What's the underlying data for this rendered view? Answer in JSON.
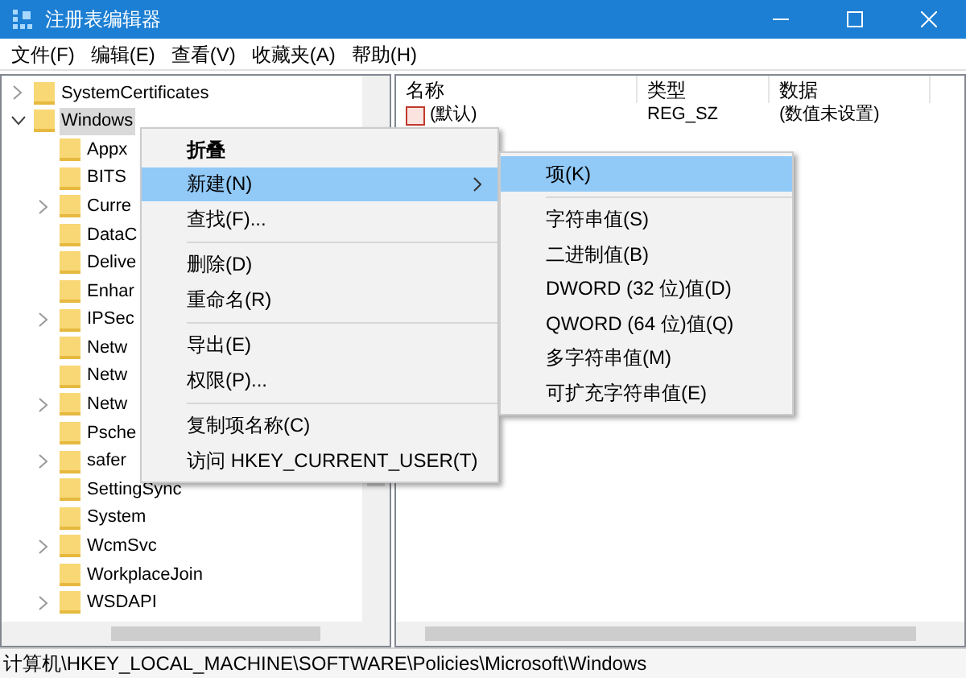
{
  "window": {
    "title": "注册表编辑器"
  },
  "menu_bar": [
    "文件(F)",
    "编辑(E)",
    "查看(V)",
    "收藏夹(A)",
    "帮助(H)"
  ],
  "tree": [
    {
      "label": "SystemCertificates",
      "expanded": false,
      "selected": false
    },
    {
      "label": "Windows",
      "expanded": true,
      "selected": true,
      "children": [
        {
          "label": "Appx",
          "selected": false
        },
        {
          "label": "BITS",
          "selected": false
        },
        {
          "label": "Curre",
          "expanded": false,
          "selected": false
        },
        {
          "label": "DataC",
          "selected": false
        },
        {
          "label": "Delive",
          "selected": false
        },
        {
          "label": "Enhar",
          "selected": false
        },
        {
          "label": "IPSec",
          "expanded": false,
          "selected": false
        },
        {
          "label": "Netw",
          "selected": false
        },
        {
          "label": "Netw",
          "selected": false
        },
        {
          "label": "Netw",
          "expanded": false,
          "selected": false
        },
        {
          "label": "Psche",
          "selected": false
        },
        {
          "label": "safer",
          "expanded": false,
          "selected": false
        },
        {
          "label": "SettingSync",
          "selected": false
        },
        {
          "label": "System",
          "selected": false
        },
        {
          "label": "WcmSvc",
          "expanded": false,
          "selected": false
        },
        {
          "label": "WorkplaceJoin",
          "selected": false
        },
        {
          "label": "WSDAPI",
          "expanded": false,
          "selected": false
        }
      ]
    }
  ],
  "values_table": {
    "columns": [
      "名称",
      "类型",
      "数据"
    ],
    "rows": [
      {
        "name": "(默认)",
        "type": "REG_SZ",
        "data": "(数值未设置)"
      }
    ]
  },
  "context_menu": [
    {
      "kind": "item",
      "label": "折叠",
      "bold": true,
      "submenu": false,
      "selected": false
    },
    {
      "kind": "item",
      "label": "新建(N)",
      "bold": false,
      "submenu": true,
      "selected": true
    },
    {
      "kind": "item",
      "label": "查找(F)...",
      "bold": false,
      "submenu": false,
      "selected": false
    },
    {
      "kind": "separator"
    },
    {
      "kind": "item",
      "label": "删除(D)",
      "bold": false,
      "submenu": false,
      "selected": false
    },
    {
      "kind": "item",
      "label": "重命名(R)",
      "bold": false,
      "submenu": false,
      "selected": false
    },
    {
      "kind": "separator"
    },
    {
      "kind": "item",
      "label": "导出(E)",
      "bold": false,
      "submenu": false,
      "selected": false
    },
    {
      "kind": "item",
      "label": "权限(P)...",
      "bold": false,
      "submenu": false,
      "selected": false
    },
    {
      "kind": "separator"
    },
    {
      "kind": "item",
      "label": "复制项名称(C)",
      "bold": false,
      "submenu": false,
      "selected": false
    },
    {
      "kind": "item",
      "label": "访问 HKEY_CURRENT_USER(T)",
      "bold": false,
      "submenu": false,
      "selected": false
    }
  ],
  "submenu": [
    {
      "kind": "item",
      "label": "项(K)",
      "selected": true
    },
    {
      "kind": "separator"
    },
    {
      "kind": "item",
      "label": "字符串值(S)",
      "selected": false
    },
    {
      "kind": "item",
      "label": "二进制值(B)",
      "selected": false
    },
    {
      "kind": "item",
      "label": "DWORD (32 位)值(D)",
      "selected": false
    },
    {
      "kind": "item",
      "label": "QWORD (64 位)值(Q)",
      "selected": false
    },
    {
      "kind": "item",
      "label": "多字符串值(M)",
      "selected": false
    },
    {
      "kind": "item",
      "label": "可扩充字符串值(E)",
      "selected": false
    }
  ],
  "status_bar": "计算机\\HKEY_LOCAL_MACHINE\\SOFTWARE\\Policies\\Microsoft\\Windows"
}
